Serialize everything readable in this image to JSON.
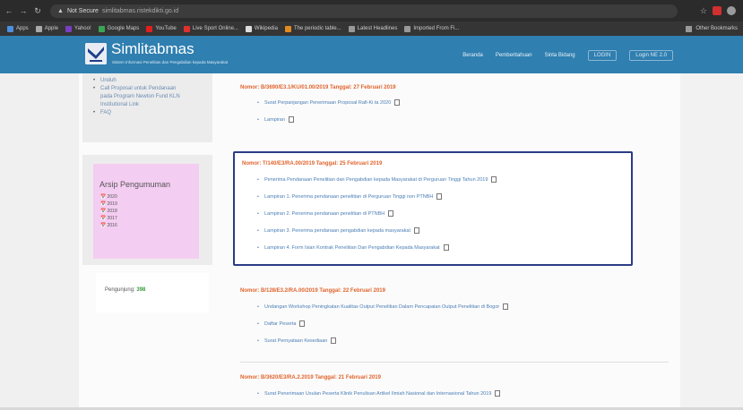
{
  "browser": {
    "security_label": "Not Secure",
    "url": "simlitabmas.ristekdikti.go.id",
    "bookmarks": [
      "Apps",
      "Apple",
      "Yahoo!",
      "Google Maps",
      "YouTube",
      "Live Sport Online...",
      "Wikipedia",
      "The periodic table...",
      "Latest Headlines",
      "Imported From Fi..."
    ],
    "other_bookmarks": "Other Bookmarks"
  },
  "site": {
    "title": "Simlitabmas",
    "subtitle": "Sistem Informasi Penelitian dan Pengabdian kepada Masyarakat",
    "nav": [
      "Beranda",
      "Pemberitahuan",
      "Sinta Bidang"
    ],
    "login_buttons": [
      "LOGIN",
      "Login NE 2.0"
    ]
  },
  "sidebar": {
    "links": [
      "Unduh",
      "Call Proposal untuk Pendanaan",
      "pada Program Newton Fund KLN",
      "Institutional Link",
      "FAQ"
    ],
    "archive": {
      "title": "Arsip Pengumuman",
      "years": [
        "2020",
        "2019",
        "2018",
        "2017",
        "2016"
      ]
    },
    "visitors": {
      "label": "Pengunjung:",
      "count": "398"
    }
  },
  "announcements": [
    {
      "heading": "Nomor: B/3690/E3.1/KU/01.00/2019    Tanggal: 27 Februari 2019",
      "items": [
        "Surat Perpanjangan Penerimaan Proposal Rafi-Ki ta 2020",
        "Lampiran"
      ]
    },
    {
      "heading": "Nomor: T/140/E3/RA.00/2019    Tanggal: 25 Februari 2019",
      "items": [
        "Penerima Pendanaan Penelitian dan Pengabdian kepada Masyarakat di Perguruan Tinggi Tahun 2019",
        "Lampiran 1. Penerima pendanaan penelitian di Perguruan Tinggi non PTNBH",
        "Lampiran 2. Penerima pendanaan penelitian di PTNBH",
        "Lampiran 3. Penerima pendanaan pengabdian kepada masyarakat",
        "Lampiran 4. Form Isian Kontrak Penelitian Dan Pengabdian Kepada Masyarakat"
      ]
    },
    {
      "heading": "Nomor: B/128/E3.2/RA.00/2019    Tanggal: 22 Februari 2019",
      "items": [
        "Undangan Workshop Peningkatan Kualitas Output Penelitian Dalam Pencapaian Output Penelitian di Bogor",
        "Daftar Peserta",
        "Surat Pernyataan Kesediaan"
      ]
    },
    {
      "heading": "Nomor: B/3620/E3/RA.2.2019    Tanggal: 21 Februari 2019",
      "items": [
        "Surat Penerimaan Usulan Peserta Klinik Penulisan Artikel Ilmiah Nasional dan Internasional Tahun 2019"
      ]
    }
  ]
}
